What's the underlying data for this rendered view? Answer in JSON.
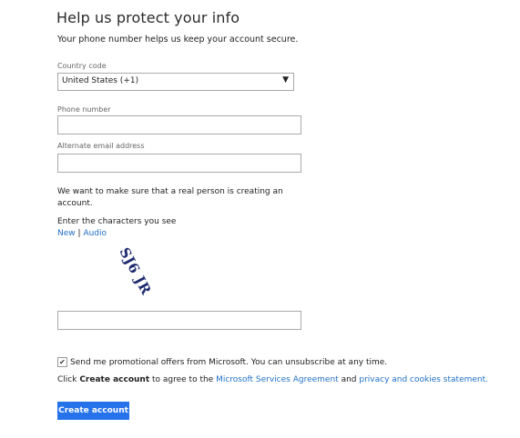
{
  "header": {
    "title": "Help us protect your info",
    "subtitle": "Your phone number helps us keep your account secure."
  },
  "country": {
    "label": "Country code",
    "value": "United States (+1)",
    "arrow_icon": "dropdown-arrow-icon"
  },
  "phone": {
    "label": "Phone number",
    "value": ""
  },
  "alt_email": {
    "label": "Alternate email address",
    "value": ""
  },
  "captcha": {
    "intro_line1": "We want to make sure that a real person is creating an",
    "intro_line2": "account.",
    "prompt": "Enter the characters you see",
    "new_link": "New",
    "separator": "|",
    "audio_link": "Audio",
    "image_text": "SJ6 JR",
    "input_value": ""
  },
  "promo": {
    "checked": true,
    "check_glyph": "✔",
    "label": "Send me promotional offers from Microsoft. You can unsubscribe at any time."
  },
  "agreement": {
    "prefix": "Click ",
    "bold": "Create account",
    "middle": " to agree to the ",
    "link1": "Microsoft Services Agreement",
    "and": " and ",
    "link2": "privacy and cookies statement",
    "suffix": "."
  },
  "actions": {
    "create_label": "Create account"
  },
  "colors": {
    "accent": "#2572eb",
    "link": "#1f6fc5",
    "captcha_ink": "#1e2a6e"
  }
}
